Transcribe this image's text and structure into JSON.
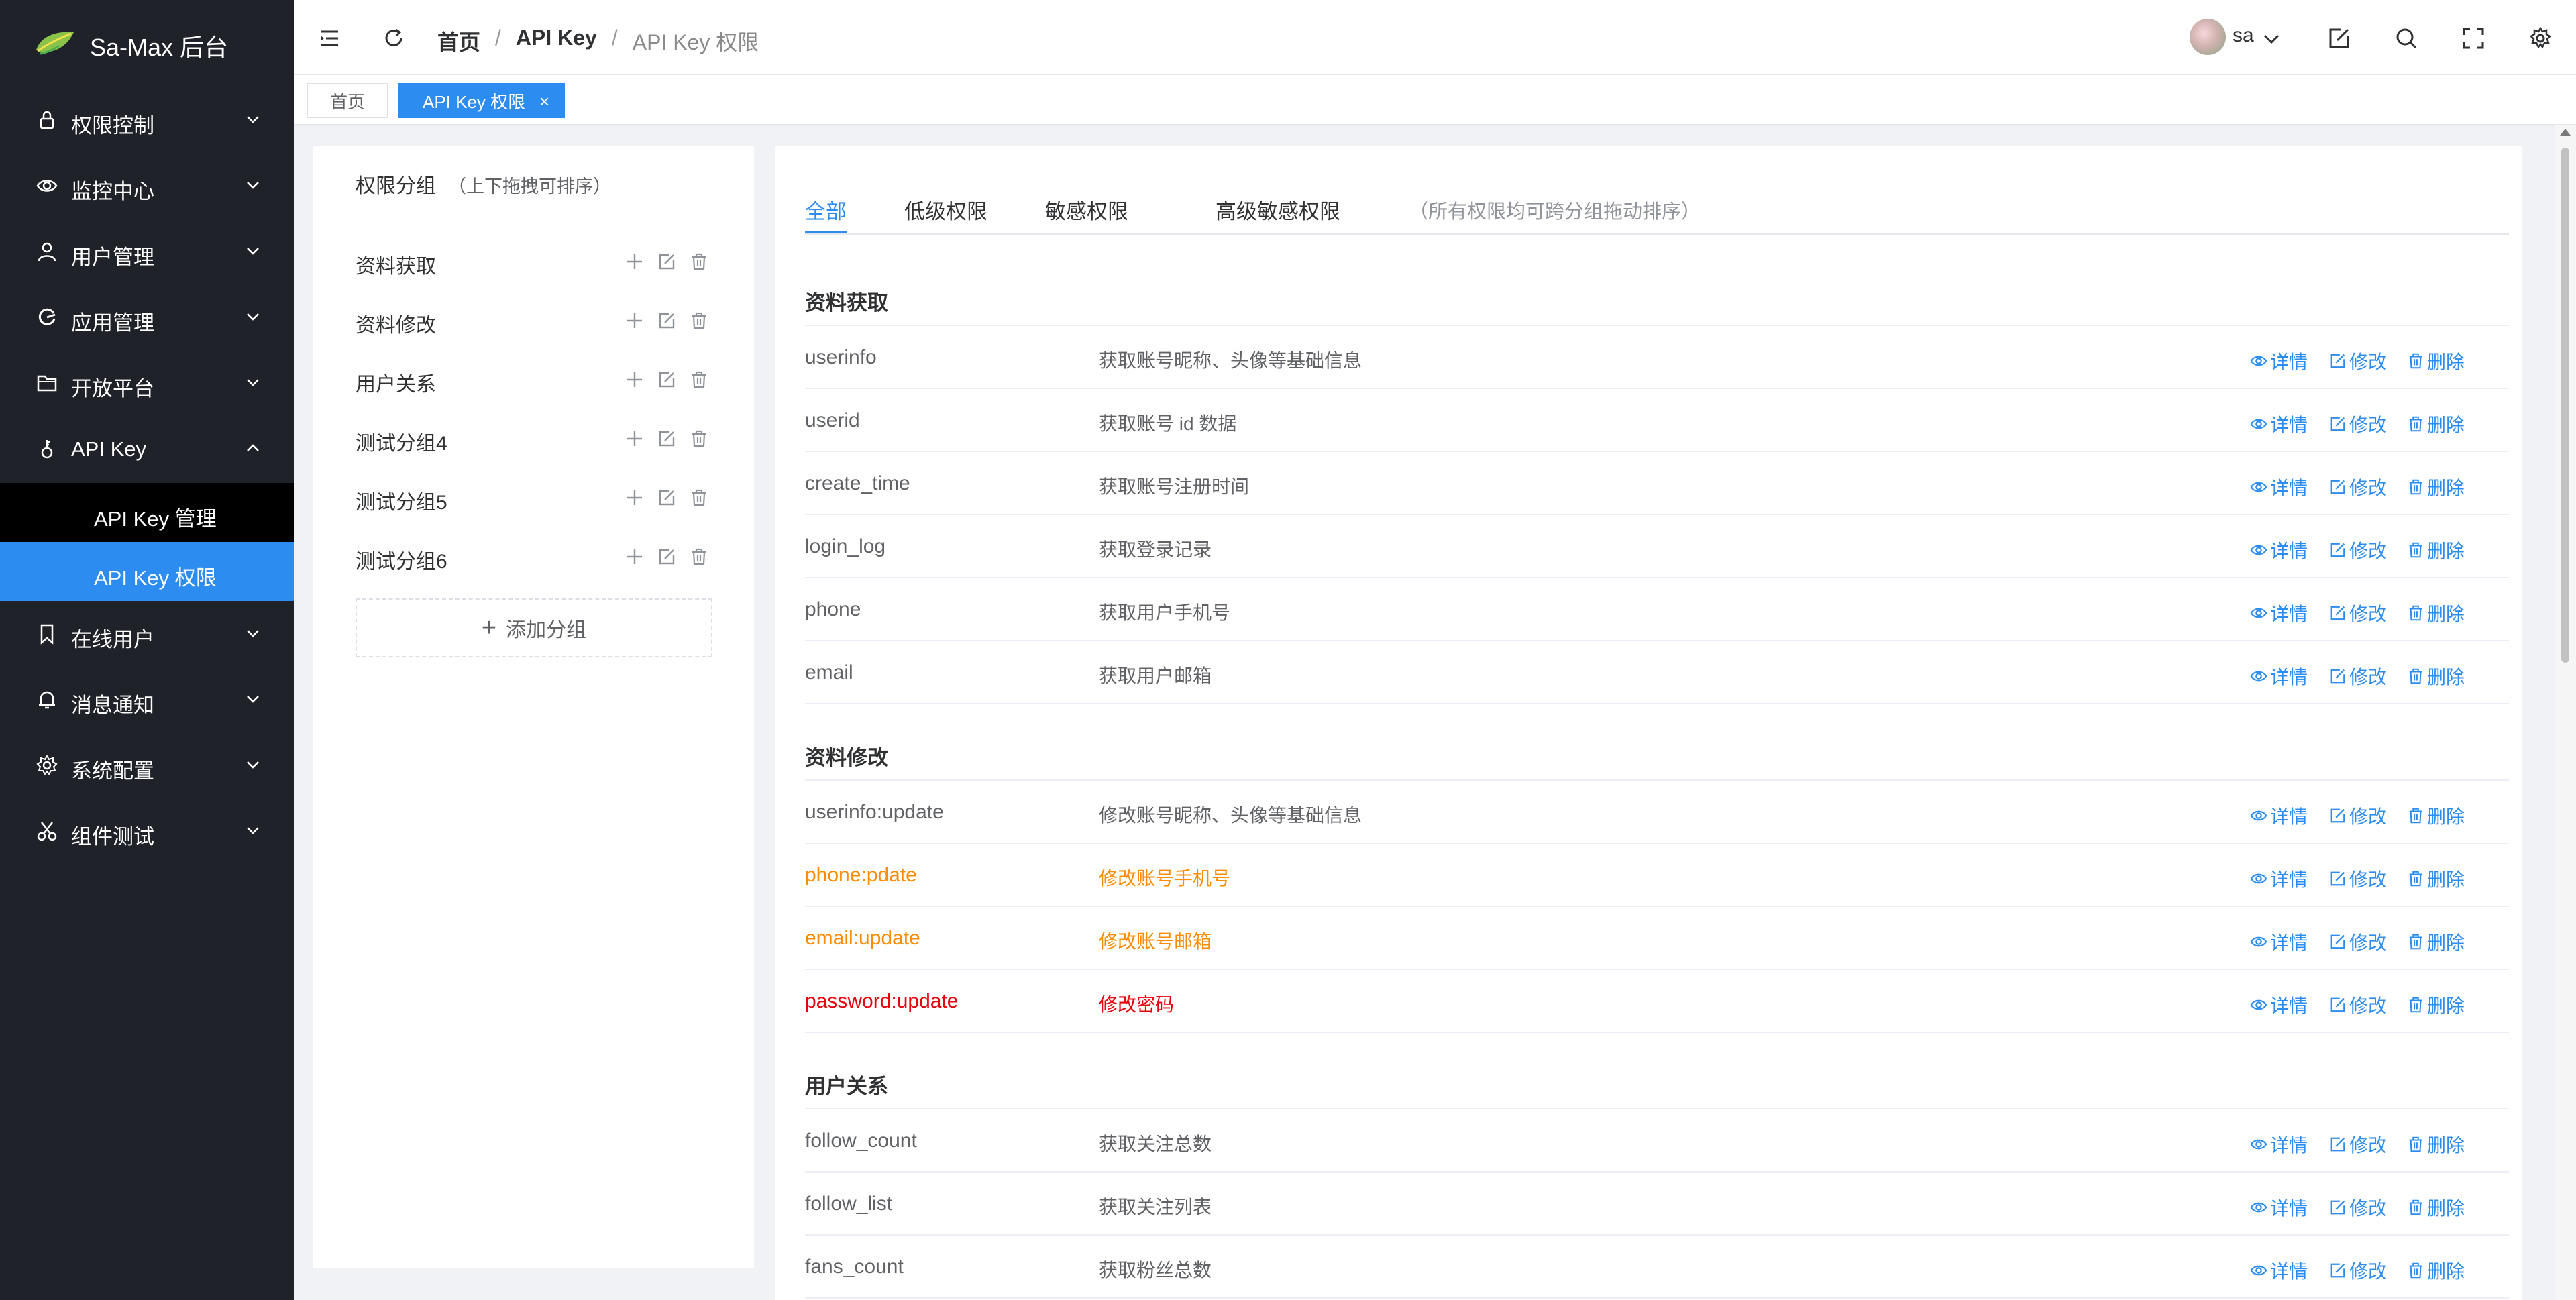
{
  "app": {
    "title": "Sa-Max 后台"
  },
  "sidebar": {
    "items": [
      {
        "label": "权限控制",
        "icon": "lock-icon"
      },
      {
        "label": "监控中心",
        "icon": "eye-icon"
      },
      {
        "label": "用户管理",
        "icon": "user-icon"
      },
      {
        "label": "应用管理",
        "icon": "app-icon"
      },
      {
        "label": "开放平台",
        "icon": "folder-icon"
      },
      {
        "label": "API Key",
        "icon": "key-icon",
        "expanded": true
      },
      {
        "label": "在线用户",
        "icon": "bookmark-icon"
      },
      {
        "label": "消息通知",
        "icon": "bell-icon"
      },
      {
        "label": "系统配置",
        "icon": "gear-icon"
      },
      {
        "label": "组件测试",
        "icon": "scissors-icon"
      }
    ],
    "subitems": [
      {
        "label": "API Key 管理"
      },
      {
        "label": "API Key 权限",
        "active": true
      }
    ]
  },
  "header": {
    "breadcrumb": [
      "首页",
      "API Key",
      "API Key 权限"
    ],
    "user_name": "sa"
  },
  "tabs": {
    "home": "首页",
    "current": "API Key 权限",
    "close": "×"
  },
  "groups": {
    "title": "权限分组",
    "hint": "（上下拖拽可排序）",
    "items": [
      "资料获取",
      "资料修改",
      "用户关系",
      "测试分组4",
      "测试分组5",
      "测试分组6"
    ],
    "add_label": "添加分组"
  },
  "perm_tabs": {
    "all": "全部",
    "low": "低级权限",
    "sensitive": "敏感权限",
    "high": "高级敏感权限",
    "hint": "（所有权限均可跨分组拖动排序）"
  },
  "actions": {
    "view": "详情",
    "edit": "修改",
    "delete": "删除"
  },
  "sections": [
    {
      "title": "资料获取",
      "rows": [
        {
          "code": "userinfo",
          "desc": "获取账号昵称、头像等基础信息",
          "level": "normal"
        },
        {
          "code": "userid",
          "desc": "获取账号 id 数据",
          "level": "normal"
        },
        {
          "code": "create_time",
          "desc": "获取账号注册时间",
          "level": "normal"
        },
        {
          "code": "login_log",
          "desc": "获取登录记录",
          "level": "normal"
        },
        {
          "code": "phone",
          "desc": "获取用户手机号",
          "level": "normal"
        },
        {
          "code": "email",
          "desc": "获取用户邮箱",
          "level": "normal"
        }
      ]
    },
    {
      "title": "资料修改",
      "rows": [
        {
          "code": "userinfo:update",
          "desc": "修改账号昵称、头像等基础信息",
          "level": "normal"
        },
        {
          "code": "phone:pdate",
          "desc": "修改账号手机号",
          "level": "sensitive"
        },
        {
          "code": "email:update",
          "desc": "修改账号邮箱",
          "level": "sensitive"
        },
        {
          "code": "password:update",
          "desc": "修改密码",
          "level": "high"
        }
      ]
    },
    {
      "title": "用户关系",
      "rows": [
        {
          "code": "follow_count",
          "desc": "获取关注总数",
          "level": "normal"
        },
        {
          "code": "follow_list",
          "desc": "获取关注列表",
          "level": "normal"
        },
        {
          "code": "fans_count",
          "desc": "获取粉丝总数",
          "level": "normal"
        }
      ]
    }
  ],
  "colors": {
    "accent": "#2d8cf0",
    "sensitive": "#ff8c00",
    "high": "#e8000c",
    "sidebar_bg": "#1f2329"
  }
}
